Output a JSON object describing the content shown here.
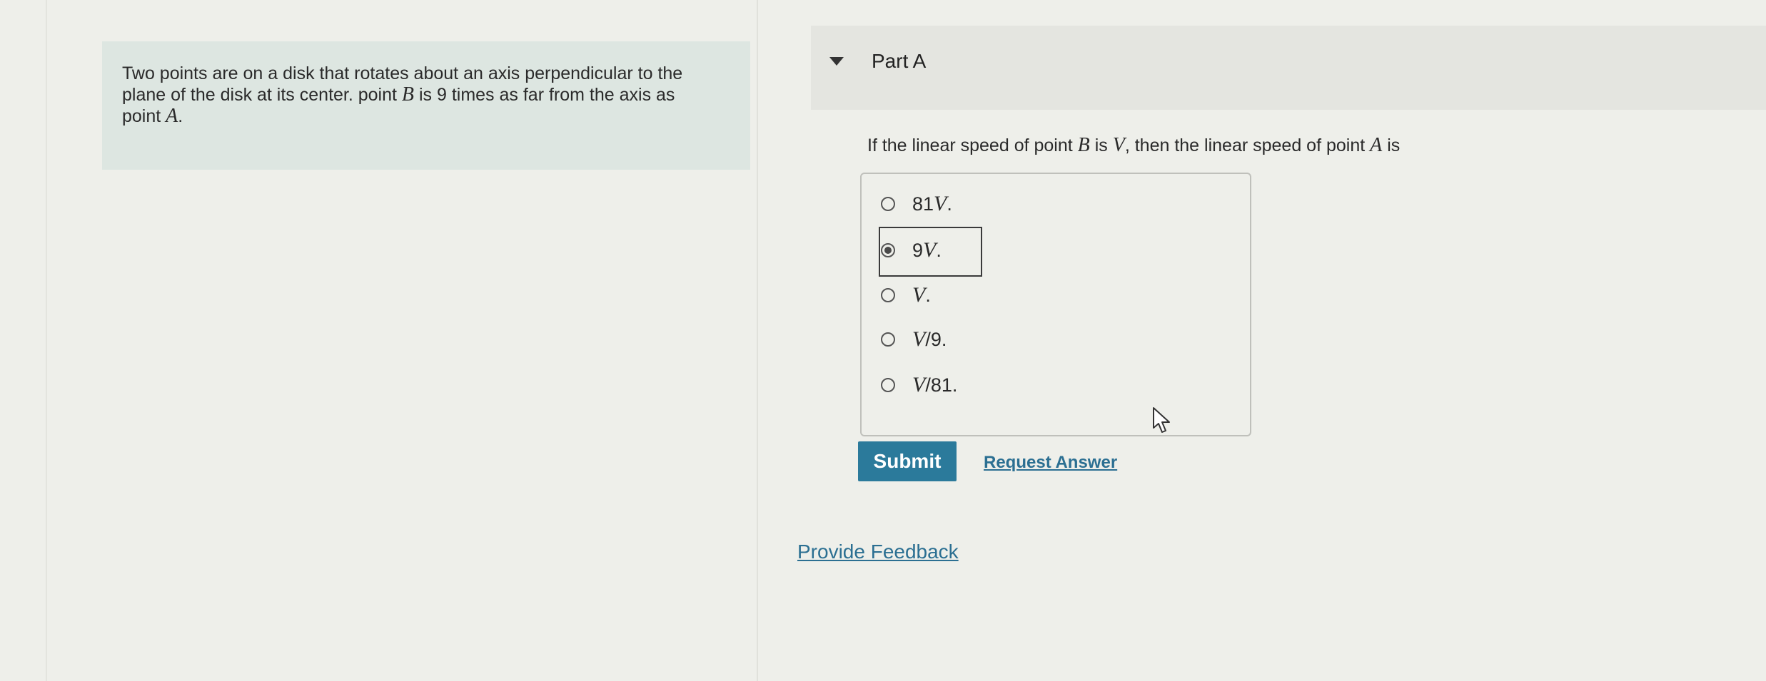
{
  "problem": {
    "line1": "Two points are on a disk that rotates about an axis perpendicular to the",
    "line2_pre": "plane of the disk at its center. point ",
    "line2_var": "B",
    "line2_post": " is 9 times as far from the axis as",
    "line3_pre": "point ",
    "line3_var": "A",
    "line3_post": "."
  },
  "part": {
    "title": "Part A"
  },
  "question": {
    "pre": "If the linear speed of point ",
    "var_b": "B",
    "mid1": " is ",
    "var_v": "V",
    "mid2": ", then the linear speed of point ",
    "var_a": "A",
    "post": " is"
  },
  "options": [
    {
      "num": "81",
      "var": "V",
      "suffix": ".",
      "selected": false
    },
    {
      "num": "9",
      "var": "V",
      "suffix": ".",
      "selected": true
    },
    {
      "num": "",
      "var": "V",
      "suffix": ".",
      "selected": false
    },
    {
      "num": "",
      "var": "V",
      "suffix": "/9.",
      "selected": false
    },
    {
      "num": "",
      "var": "V",
      "suffix": "/81.",
      "selected": false
    }
  ],
  "buttons": {
    "submit": "Submit",
    "request_answer": "Request Answer"
  },
  "links": {
    "provide_feedback": "Provide Feedback"
  },
  "colors": {
    "primary": "#2b7a9b",
    "link": "#2b6f92",
    "problem_bg": "#dde6e1"
  }
}
